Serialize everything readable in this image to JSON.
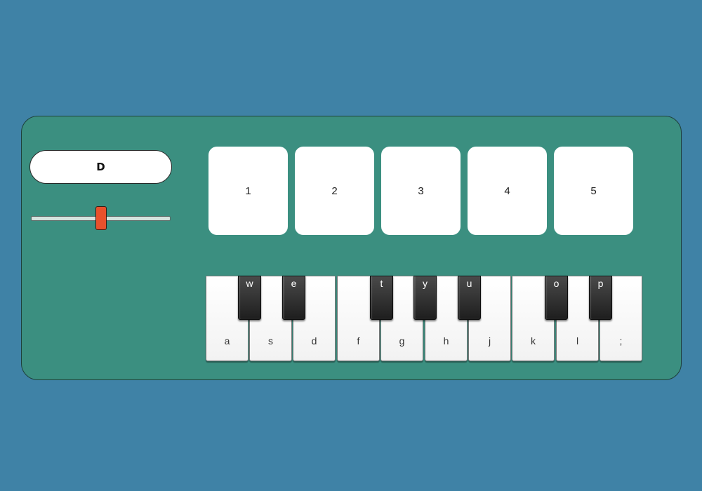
{
  "note_display": "D",
  "slider": {
    "value_fraction": 0.5
  },
  "pads": [
    "1",
    "2",
    "3",
    "4",
    "5"
  ],
  "keyboard": {
    "white_keys": [
      "a",
      "s",
      "d",
      "f",
      "g",
      "h",
      "j",
      "k",
      "l",
      ";"
    ],
    "black_keys": [
      "w",
      "e",
      "t",
      "y",
      "u",
      "o",
      "p"
    ]
  },
  "colors": {
    "page_background": "#3f82a6",
    "panel": "#3b8f80",
    "slider_thumb": "#e8512c"
  }
}
